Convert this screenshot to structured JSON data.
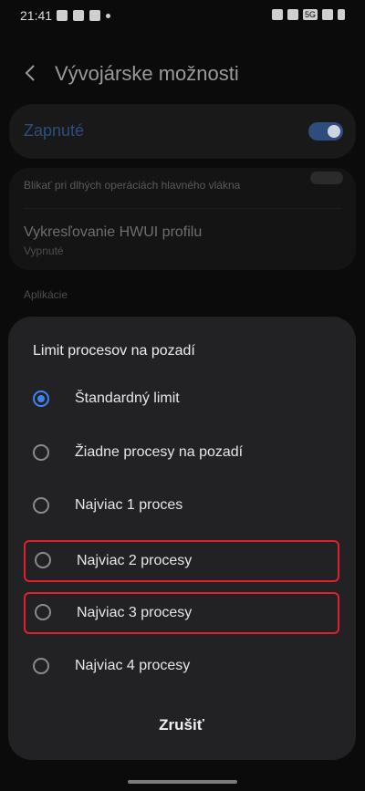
{
  "status_bar": {
    "time": "21:41",
    "network": "5G"
  },
  "header": {
    "title": "Vývojárske možnosti"
  },
  "master_switch": {
    "label": "Zapnuté",
    "on": true,
    "accent": "#2d4e7c"
  },
  "background_list": {
    "item1": "Blikať pri dlhých operáciách hlavného vlákna",
    "item2_title": "Vykresľovanie HWUI profilu",
    "item2_subtitle": "Vypnuté",
    "section_header": "Aplikácie"
  },
  "dialog": {
    "title": "Limit procesov na pozadí",
    "selected_index": 0,
    "options": [
      {
        "label": "Štandardný limit",
        "checked": true
      },
      {
        "label": "Žiadne procesy na pozadí",
        "checked": false
      },
      {
        "label": "Najviac 1 proces",
        "checked": false
      },
      {
        "label": "Najviac 2 procesy",
        "checked": false,
        "highlighted": true
      },
      {
        "label": "Najviac 3 procesy",
        "checked": false,
        "highlighted": true
      },
      {
        "label": "Najviac 4 procesy",
        "checked": false
      }
    ],
    "cancel_label": "Zrušiť"
  },
  "colors": {
    "radio_selected": "#3e83f0",
    "highlight": "#e0202a"
  }
}
